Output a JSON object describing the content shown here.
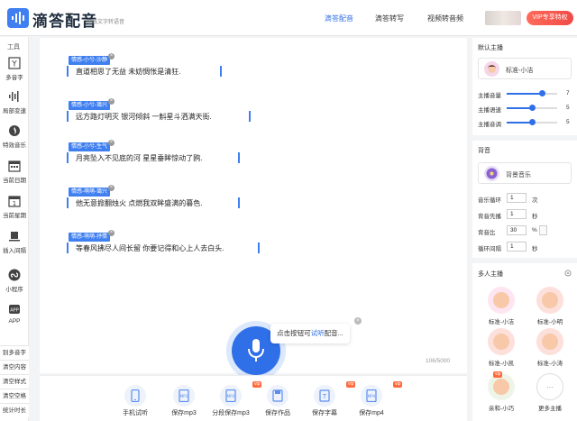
{
  "header": {
    "app_name": "滴答配音",
    "app_sub": "在线文字转语音",
    "nav": [
      "滴答配音",
      "滴答转写",
      "视频转音频"
    ],
    "vip_label": "VIP专享特权"
  },
  "sidebar": {
    "title": "工具",
    "items": [
      "多音字",
      "局部变速",
      "特效音乐",
      "当前日期",
      "当前星期",
      "插入间隔",
      "小程序",
      "APP"
    ],
    "bottom_items": [
      "别多音字",
      "清空内容",
      "清空样式",
      "清空空格",
      "统计时长"
    ]
  },
  "editor": {
    "lines": [
      {
        "tag": "情感-小兮-沙静",
        "text": "直道相思了无益 未妨惆怅是清狂."
      },
      {
        "tag": "情感-小兮-蔼兴",
        "text": "远方路灯明灭 银河倾斜 一斛星斗洒满天街."
      },
      {
        "tag": "情感-小兮-生气",
        "text": "月亮坠入不见底的河 星星垂眸惊动了鸥."
      },
      {
        "tag": "情感-萌萌-蔼兴",
        "text": "他无意掀翻烛火 点燃我双眸盛满的暮色."
      },
      {
        "tag": "情感-萌萌-抒情",
        "text": "等春风拂尽人间长留 你要记得和心上人去白头."
      }
    ],
    "counter": "106/5000",
    "close_glyph": "×"
  },
  "mic": {
    "tip_before": "点击按钮可",
    "tip_highlight": "试听",
    "tip_after": "配音...",
    "close_glyph": "×"
  },
  "toolbar": {
    "buttons": [
      "手机试听",
      "保存mp3",
      "分段保存mp3",
      "保存作品",
      "保存字幕",
      "保存mp4"
    ],
    "vip_badge": "vip"
  },
  "right_panel": {
    "default_anchor_title": "默认主播",
    "default_anchor_name": "标准-小洁",
    "sliders": [
      {
        "label": "主播音量",
        "value": 7
      },
      {
        "label": "主播语速",
        "value": 5
      },
      {
        "label": "主播音调",
        "value": 5
      }
    ],
    "bgm_title": "背音",
    "bgm_card_label": "背景音乐",
    "bgm_settings": [
      {
        "label": "音乐循环",
        "value": "1",
        "unit": "次"
      },
      {
        "label": "背音先播",
        "value": "1",
        "unit": "秒"
      },
      {
        "label": "背音比",
        "value": "30",
        "unit": "%"
      },
      {
        "label": "循环间隔",
        "value": "1",
        "unit": "秒"
      }
    ],
    "multi_title": "多人主播",
    "multi_anchors": [
      "标准-小洁",
      "标准-小明",
      "标准-小凯",
      "标准-小涛",
      "亲和-小巧",
      "更多主播"
    ],
    "more_glyph": "···"
  },
  "colors": {
    "primary": "#2f6fe8",
    "vip": "#f04a45",
    "tag": "#3f7ff0"
  }
}
